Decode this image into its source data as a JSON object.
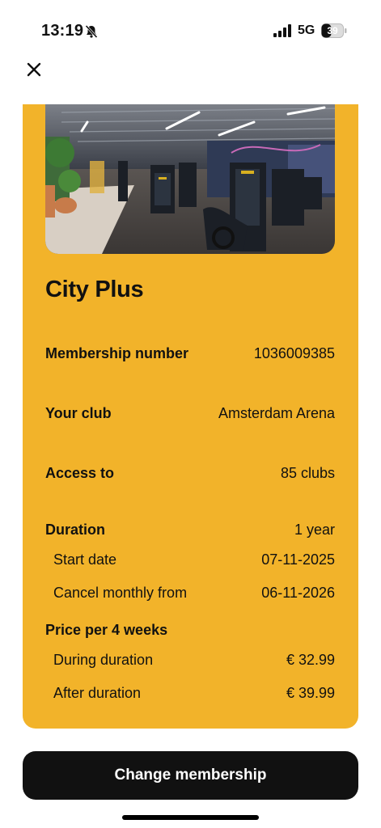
{
  "status_bar": {
    "time": "13:19",
    "network": "5G",
    "battery": "39"
  },
  "card": {
    "plan_name": "City Plus",
    "details": [
      {
        "label": "Membership number",
        "value": "1036009385"
      },
      {
        "label": "Your club",
        "value": "Amsterdam Arena"
      },
      {
        "label": "Access to",
        "value": "85 clubs"
      },
      {
        "label": "Duration",
        "value": "1 year"
      },
      {
        "label": "Start date",
        "value": "07-11-2025"
      },
      {
        "label": "Cancel monthly from",
        "value": "06-11-2026"
      },
      {
        "label": "Price per 4 weeks",
        "value": ""
      },
      {
        "label": "During duration",
        "value": "€ 32.99"
      },
      {
        "label": "After duration",
        "value": "€ 39.99"
      }
    ]
  },
  "actions": {
    "change_membership": "Change membership"
  },
  "colors": {
    "card_background": "#f2b32a",
    "button_background": "#111111"
  },
  "icons": [
    "bell-slash-icon",
    "signal-icon",
    "battery-icon",
    "close-icon"
  ]
}
